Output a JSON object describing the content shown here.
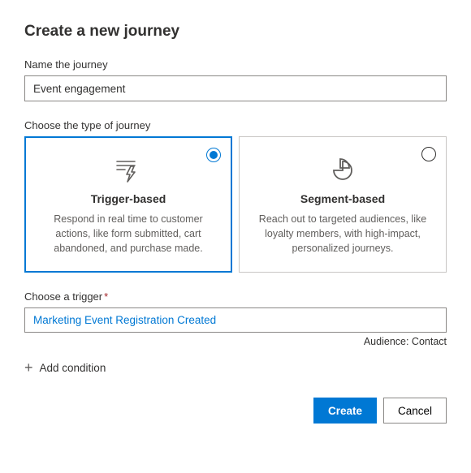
{
  "title": "Create a new journey",
  "name_field": {
    "label": "Name the journey",
    "value": "Event engagement"
  },
  "type_section": {
    "label": "Choose the type of journey",
    "cards": [
      {
        "title": "Trigger-based",
        "desc": "Respond in real time to customer actions, like form submitted, cart abandoned, and purchase made.",
        "selected": true
      },
      {
        "title": "Segment-based",
        "desc": "Reach out to targeted audiences, like loyalty members, with high-impact, personalized journeys.",
        "selected": false
      }
    ]
  },
  "trigger_section": {
    "label": "Choose a trigger",
    "value": "Marketing Event Registration Created",
    "audience_label": "Audience: Contact"
  },
  "add_condition_label": "Add condition",
  "buttons": {
    "create": "Create",
    "cancel": "Cancel"
  }
}
